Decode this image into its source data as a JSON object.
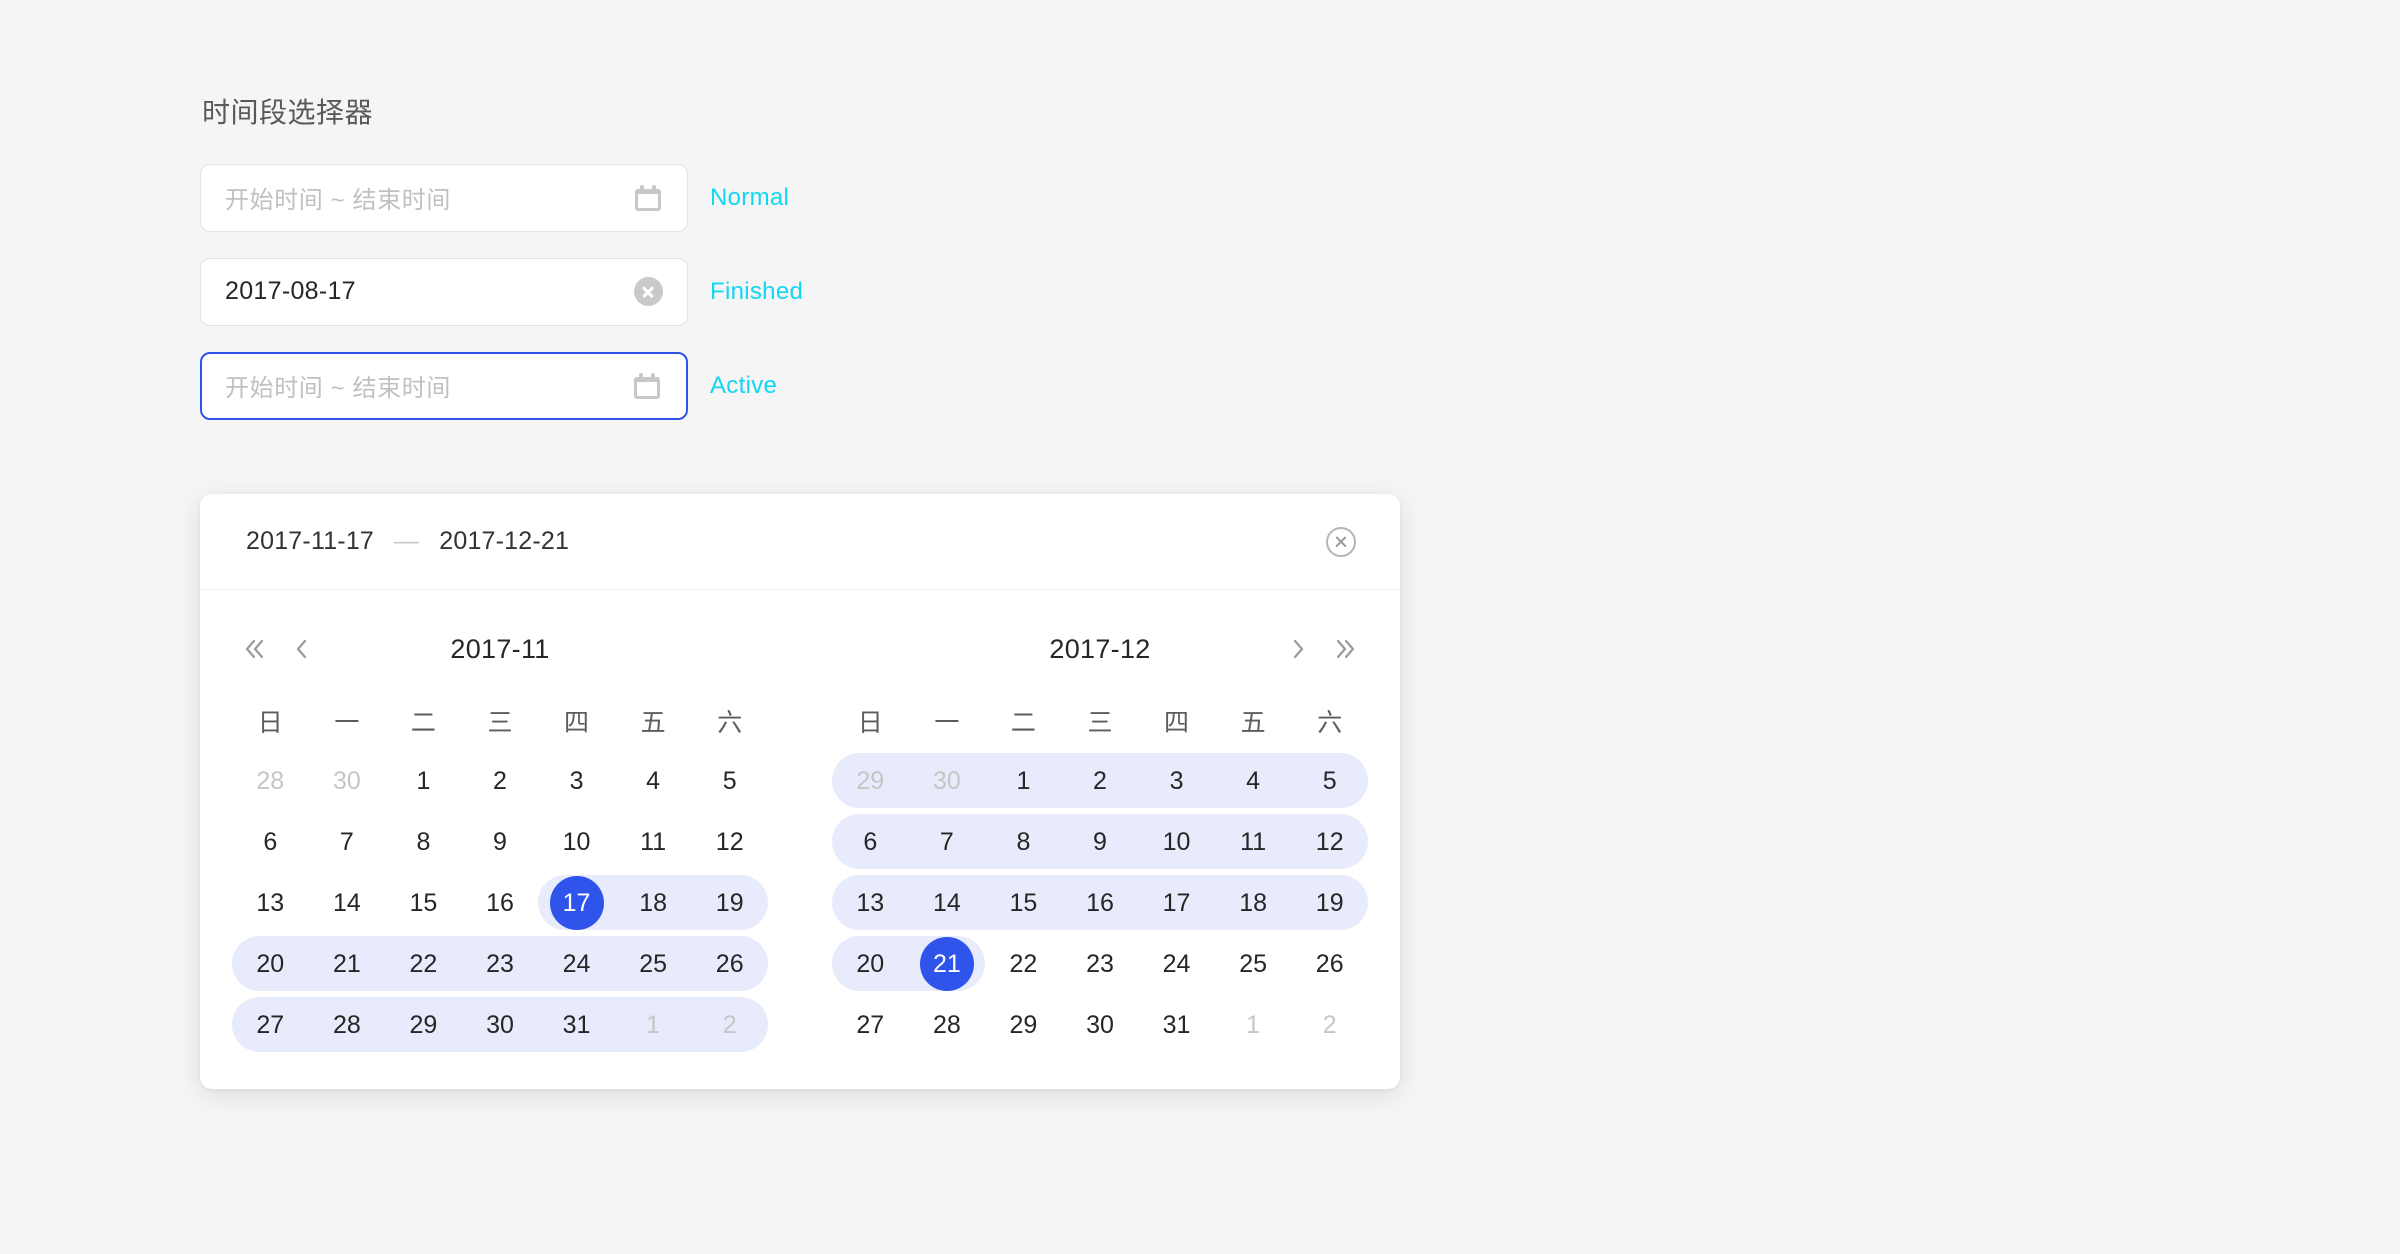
{
  "page": {
    "title": "时间段选择器"
  },
  "fields": [
    {
      "name": "normal",
      "placeholder": "开始时间 ~ 结束时间",
      "value": "",
      "state_label": "Normal",
      "suffix_icon": "calendar-icon"
    },
    {
      "name": "finished",
      "placeholder": "开始时间 ~ 结束时间",
      "value": "2017-08-17",
      "state_label": "Finished",
      "suffix_icon": "clear-circle-icon"
    },
    {
      "name": "active",
      "placeholder": "开始时间 ~ 结束时间",
      "value": "",
      "state_label": "Active",
      "suffix_icon": "calendar-icon"
    }
  ],
  "picker": {
    "header": {
      "start_date": "2017-11-17",
      "separator": "—",
      "end_date": "2017-12-21",
      "clear_icon": "clear-circle-outline-icon"
    },
    "nav": {
      "prev_year": "«",
      "prev_month": "‹",
      "next_month": "›",
      "next_year": "»"
    },
    "weekdays": [
      "日",
      "一",
      "二",
      "三",
      "四",
      "五",
      "六"
    ],
    "months": [
      {
        "title": "2017-11",
        "days": [
          {
            "label": "28",
            "muted": true,
            "in_range": false,
            "range_start": false,
            "range_end": false,
            "selected": false
          },
          {
            "label": "30",
            "muted": true,
            "in_range": false,
            "range_start": false,
            "range_end": false,
            "selected": false
          },
          {
            "label": "1",
            "muted": false,
            "in_range": false,
            "range_start": false,
            "range_end": false,
            "selected": false
          },
          {
            "label": "2",
            "muted": false,
            "in_range": false,
            "range_start": false,
            "range_end": false,
            "selected": false
          },
          {
            "label": "3",
            "muted": false,
            "in_range": false,
            "range_start": false,
            "range_end": false,
            "selected": false
          },
          {
            "label": "4",
            "muted": false,
            "in_range": false,
            "range_start": false,
            "range_end": false,
            "selected": false
          },
          {
            "label": "5",
            "muted": false,
            "in_range": false,
            "range_start": false,
            "range_end": false,
            "selected": false
          },
          {
            "label": "6",
            "muted": false,
            "in_range": false,
            "range_start": false,
            "range_end": false,
            "selected": false
          },
          {
            "label": "7",
            "muted": false,
            "in_range": false,
            "range_start": false,
            "range_end": false,
            "selected": false
          },
          {
            "label": "8",
            "muted": false,
            "in_range": false,
            "range_start": false,
            "range_end": false,
            "selected": false
          },
          {
            "label": "9",
            "muted": false,
            "in_range": false,
            "range_start": false,
            "range_end": false,
            "selected": false
          },
          {
            "label": "10",
            "muted": false,
            "in_range": false,
            "range_start": false,
            "range_end": false,
            "selected": false
          },
          {
            "label": "11",
            "muted": false,
            "in_range": false,
            "range_start": false,
            "range_end": false,
            "selected": false
          },
          {
            "label": "12",
            "muted": false,
            "in_range": false,
            "range_start": false,
            "range_end": false,
            "selected": false
          },
          {
            "label": "13",
            "muted": false,
            "in_range": false,
            "range_start": false,
            "range_end": false,
            "selected": false
          },
          {
            "label": "14",
            "muted": false,
            "in_range": false,
            "range_start": false,
            "range_end": false,
            "selected": false
          },
          {
            "label": "15",
            "muted": false,
            "in_range": false,
            "range_start": false,
            "range_end": false,
            "selected": false
          },
          {
            "label": "16",
            "muted": false,
            "in_range": false,
            "range_start": false,
            "range_end": false,
            "selected": false
          },
          {
            "label": "17",
            "muted": false,
            "in_range": true,
            "range_start": true,
            "range_end": false,
            "selected": true
          },
          {
            "label": "18",
            "muted": false,
            "in_range": true,
            "range_start": false,
            "range_end": false,
            "selected": false
          },
          {
            "label": "19",
            "muted": false,
            "in_range": true,
            "range_start": false,
            "range_end": true,
            "selected": false
          },
          {
            "label": "20",
            "muted": false,
            "in_range": true,
            "range_start": true,
            "range_end": false,
            "selected": false
          },
          {
            "label": "21",
            "muted": false,
            "in_range": true,
            "range_start": false,
            "range_end": false,
            "selected": false
          },
          {
            "label": "22",
            "muted": false,
            "in_range": true,
            "range_start": false,
            "range_end": false,
            "selected": false
          },
          {
            "label": "23",
            "muted": false,
            "in_range": true,
            "range_start": false,
            "range_end": false,
            "selected": false
          },
          {
            "label": "24",
            "muted": false,
            "in_range": true,
            "range_start": false,
            "range_end": false,
            "selected": false
          },
          {
            "label": "25",
            "muted": false,
            "in_range": true,
            "range_start": false,
            "range_end": false,
            "selected": false
          },
          {
            "label": "26",
            "muted": false,
            "in_range": true,
            "range_start": false,
            "range_end": true,
            "selected": false
          },
          {
            "label": "27",
            "muted": false,
            "in_range": true,
            "range_start": true,
            "range_end": false,
            "selected": false
          },
          {
            "label": "28",
            "muted": false,
            "in_range": true,
            "range_start": false,
            "range_end": false,
            "selected": false
          },
          {
            "label": "29",
            "muted": false,
            "in_range": true,
            "range_start": false,
            "range_end": false,
            "selected": false
          },
          {
            "label": "30",
            "muted": false,
            "in_range": true,
            "range_start": false,
            "range_end": false,
            "selected": false
          },
          {
            "label": "31",
            "muted": false,
            "in_range": true,
            "range_start": false,
            "range_end": false,
            "selected": false
          },
          {
            "label": "1",
            "muted": true,
            "in_range": true,
            "range_start": false,
            "range_end": false,
            "selected": false
          },
          {
            "label": "2",
            "muted": true,
            "in_range": true,
            "range_start": false,
            "range_end": true,
            "selected": false
          }
        ]
      },
      {
        "title": "2017-12",
        "days": [
          {
            "label": "29",
            "muted": true,
            "in_range": true,
            "range_start": true,
            "range_end": false,
            "selected": false
          },
          {
            "label": "30",
            "muted": true,
            "in_range": true,
            "range_start": false,
            "range_end": false,
            "selected": false
          },
          {
            "label": "1",
            "muted": false,
            "in_range": true,
            "range_start": false,
            "range_end": false,
            "selected": false
          },
          {
            "label": "2",
            "muted": false,
            "in_range": true,
            "range_start": false,
            "range_end": false,
            "selected": false
          },
          {
            "label": "3",
            "muted": false,
            "in_range": true,
            "range_start": false,
            "range_end": false,
            "selected": false
          },
          {
            "label": "4",
            "muted": false,
            "in_range": true,
            "range_start": false,
            "range_end": false,
            "selected": false
          },
          {
            "label": "5",
            "muted": false,
            "in_range": true,
            "range_start": false,
            "range_end": true,
            "selected": false
          },
          {
            "label": "6",
            "muted": false,
            "in_range": true,
            "range_start": true,
            "range_end": false,
            "selected": false
          },
          {
            "label": "7",
            "muted": false,
            "in_range": true,
            "range_start": false,
            "range_end": false,
            "selected": false
          },
          {
            "label": "8",
            "muted": false,
            "in_range": true,
            "range_start": false,
            "range_end": false,
            "selected": false
          },
          {
            "label": "9",
            "muted": false,
            "in_range": true,
            "range_start": false,
            "range_end": false,
            "selected": false
          },
          {
            "label": "10",
            "muted": false,
            "in_range": true,
            "range_start": false,
            "range_end": false,
            "selected": false
          },
          {
            "label": "11",
            "muted": false,
            "in_range": true,
            "range_start": false,
            "range_end": false,
            "selected": false
          },
          {
            "label": "12",
            "muted": false,
            "in_range": true,
            "range_start": false,
            "range_end": true,
            "selected": false
          },
          {
            "label": "13",
            "muted": false,
            "in_range": true,
            "range_start": true,
            "range_end": false,
            "selected": false
          },
          {
            "label": "14",
            "muted": false,
            "in_range": true,
            "range_start": false,
            "range_end": false,
            "selected": false
          },
          {
            "label": "15",
            "muted": false,
            "in_range": true,
            "range_start": false,
            "range_end": false,
            "selected": false
          },
          {
            "label": "16",
            "muted": false,
            "in_range": true,
            "range_start": false,
            "range_end": false,
            "selected": false
          },
          {
            "label": "17",
            "muted": false,
            "in_range": true,
            "range_start": false,
            "range_end": false,
            "selected": false
          },
          {
            "label": "18",
            "muted": false,
            "in_range": true,
            "range_start": false,
            "range_end": false,
            "selected": false
          },
          {
            "label": "19",
            "muted": false,
            "in_range": true,
            "range_start": false,
            "range_end": true,
            "selected": false
          },
          {
            "label": "20",
            "muted": false,
            "in_range": true,
            "range_start": true,
            "range_end": false,
            "selected": false
          },
          {
            "label": "21",
            "muted": false,
            "in_range": true,
            "range_start": false,
            "range_end": true,
            "selected": true
          },
          {
            "label": "22",
            "muted": false,
            "in_range": false,
            "range_start": false,
            "range_end": false,
            "selected": false
          },
          {
            "label": "23",
            "muted": false,
            "in_range": false,
            "range_start": false,
            "range_end": false,
            "selected": false
          },
          {
            "label": "24",
            "muted": false,
            "in_range": false,
            "range_start": false,
            "range_end": false,
            "selected": false
          },
          {
            "label": "25",
            "muted": false,
            "in_range": false,
            "range_start": false,
            "range_end": false,
            "selected": false
          },
          {
            "label": "26",
            "muted": false,
            "in_range": false,
            "range_start": false,
            "range_end": false,
            "selected": false
          },
          {
            "label": "27",
            "muted": false,
            "in_range": false,
            "range_start": false,
            "range_end": false,
            "selected": false
          },
          {
            "label": "28",
            "muted": false,
            "in_range": false,
            "range_start": false,
            "range_end": false,
            "selected": false
          },
          {
            "label": "29",
            "muted": false,
            "in_range": false,
            "range_start": false,
            "range_end": false,
            "selected": false
          },
          {
            "label": "30",
            "muted": false,
            "in_range": false,
            "range_start": false,
            "range_end": false,
            "selected": false
          },
          {
            "label": "31",
            "muted": false,
            "in_range": false,
            "range_start": false,
            "range_end": false,
            "selected": false
          },
          {
            "label": "1",
            "muted": true,
            "in_range": false,
            "range_start": false,
            "range_end": false,
            "selected": false
          },
          {
            "label": "2",
            "muted": true,
            "in_range": false,
            "range_start": false,
            "range_end": false,
            "selected": false
          }
        ]
      }
    ]
  },
  "colors": {
    "accent_selected": "#2f54eb",
    "range_band": "#e8ebfb",
    "state_label": "#11d7f2",
    "page_background": "#f5f5f5"
  }
}
